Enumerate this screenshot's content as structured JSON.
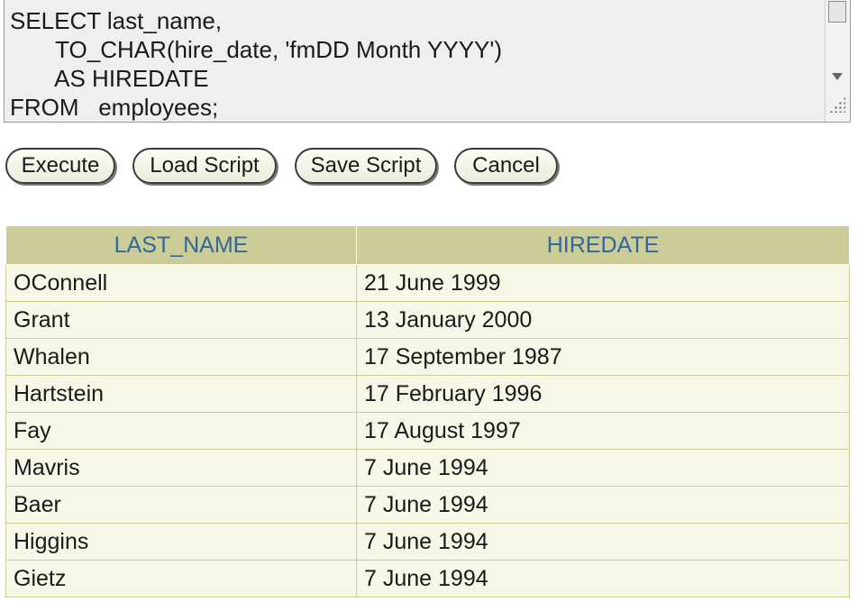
{
  "editor": {
    "sql_lines": [
      "SELECT last_name,",
      "       TO_CHAR(hire_date, 'fmDD Month YYYY')",
      "       AS HIREDATE",
      "FROM   employees;"
    ]
  },
  "toolbar": {
    "execute_label": "Execute",
    "load_label": "Load Script",
    "save_label": "Save Script",
    "cancel_label": "Cancel"
  },
  "results": {
    "columns": [
      "LAST_NAME",
      "HIREDATE"
    ],
    "rows": [
      [
        "OConnell",
        "21 June 1999"
      ],
      [
        "Grant",
        "13 January 2000"
      ],
      [
        "Whalen",
        "17 September 1987"
      ],
      [
        "Hartstein",
        "17 February 1996"
      ],
      [
        "Fay",
        "17 August 1997"
      ],
      [
        "Mavris",
        "7 June 1994"
      ],
      [
        "Baer",
        "7 June 1994"
      ],
      [
        "Higgins",
        "7 June 1994"
      ],
      [
        "Gietz",
        "7 June 1994"
      ]
    ]
  },
  "colors": {
    "header_bg": "#cccc99",
    "header_text": "#336699",
    "row_bg": "#f7f7e7",
    "editor_bg": "#efefef"
  },
  "icons": {
    "scroll_down": "triangle-down-icon",
    "resize": "resize-grip-icon"
  }
}
